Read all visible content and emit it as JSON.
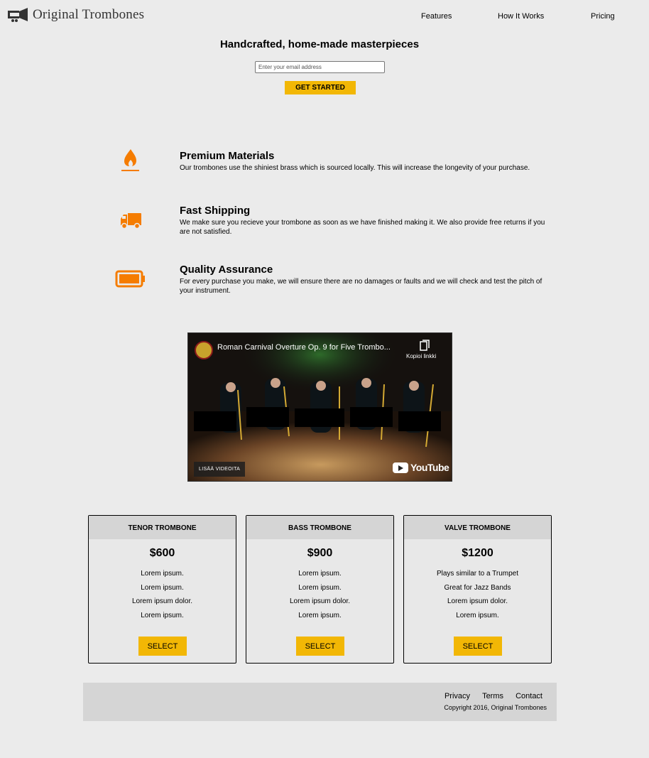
{
  "header": {
    "logo_text": "Original Trombones",
    "nav": [
      {
        "label": "Features"
      },
      {
        "label": "How It Works"
      },
      {
        "label": "Pricing"
      }
    ]
  },
  "hero": {
    "title": "Handcrafted, home-made masterpieces",
    "email_placeholder": "Enter your email address",
    "cta_label": "GET STARTED"
  },
  "features": [
    {
      "icon": "fire-icon",
      "title": "Premium Materials",
      "description": "Our trombones use the shiniest brass which is sourced locally. This will increase the longevity of your purchase."
    },
    {
      "icon": "truck-icon",
      "title": "Fast Shipping",
      "description": "We make sure you recieve your trombone as soon as we have finished making it. We also provide free returns if you are not satisfied."
    },
    {
      "icon": "battery-icon",
      "title": "Quality Assurance",
      "description": "For every purchase you make, we will ensure there are no damages or faults and we will check and test the pitch of your instrument."
    }
  ],
  "video": {
    "title": "Roman Carnival Overture Op. 9 for Five Trombo...",
    "copy_link_label": "Kopioi linkki",
    "more_videos_label": "LISÄÄ VIDEOITA",
    "brand": "YouTube"
  },
  "pricing": [
    {
      "name": "TENOR TROMBONE",
      "price": "$600",
      "features": [
        "Lorem ipsum.",
        "Lorem ipsum.",
        "Lorem ipsum dolor.",
        "Lorem ipsum."
      ],
      "button": "SELECT"
    },
    {
      "name": "BASS TROMBONE",
      "price": "$900",
      "features": [
        "Lorem ipsum.",
        "Lorem ipsum.",
        "Lorem ipsum dolor.",
        "Lorem ipsum."
      ],
      "button": "SELECT"
    },
    {
      "name": "VALVE TROMBONE",
      "price": "$1200",
      "features": [
        "Plays similar to a Trumpet",
        "Great for Jazz Bands",
        "Lorem ipsum dolor.",
        "Lorem ipsum."
      ],
      "button": "SELECT"
    }
  ],
  "footer": {
    "links": [
      {
        "label": "Privacy"
      },
      {
        "label": "Terms"
      },
      {
        "label": "Contact"
      }
    ],
    "copyright": "Copyright 2016, Original Trombones"
  },
  "colors": {
    "accent": "#f2b705",
    "icon": "#f57c00",
    "background": "#ebebeb"
  }
}
